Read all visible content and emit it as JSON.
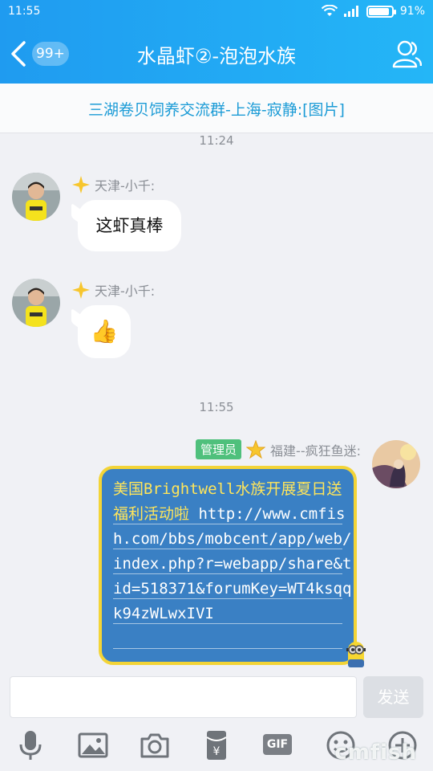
{
  "status_bar": {
    "time": "11:55",
    "battery": "91%",
    "battery_level": 0.91
  },
  "header": {
    "unread_badge": "99+",
    "title": "水晶虾②-泡泡水族"
  },
  "pinned_notice": {
    "text": "三湖卷贝饲养交流群-上海-寂静:[图片]"
  },
  "timestamps": [
    "11:24",
    "11:55"
  ],
  "messages": [
    {
      "sender": "天津-小千:",
      "text": "这虾真棒"
    },
    {
      "sender": "天津-小千:",
      "emoji": "👍"
    },
    {
      "tag": "管理员",
      "sender": "福建--疯狂鱼迷:",
      "headline": "美国Brightwell水族开展夏日送福利活动啦",
      "link": " http://www.cmfish.com/bbs/mobcent/app/web/index.php?r=webapp/share&tid=518371&forumKey=WT4ksqqk94zWLwxIVI"
    }
  ],
  "composer": {
    "input_value": "",
    "send_label": "发送"
  },
  "toolbar": {
    "gif_label": "GIF"
  },
  "watermark": "cmfish",
  "colors": {
    "header": "#1f9bf0",
    "notice_text": "#1b9bd6",
    "admin_tag": "#4fc07c",
    "card_bg": "#3a80c4",
    "card_border": "#f3d437"
  },
  "icons": [
    "back-icon",
    "contacts-icon",
    "wifi-icon",
    "signal-icon",
    "battery-icon",
    "vip-star-icon",
    "mic-icon",
    "image-icon",
    "camera-icon",
    "red-packet-icon",
    "gif-icon",
    "emoji-icon",
    "plus-icon"
  ]
}
